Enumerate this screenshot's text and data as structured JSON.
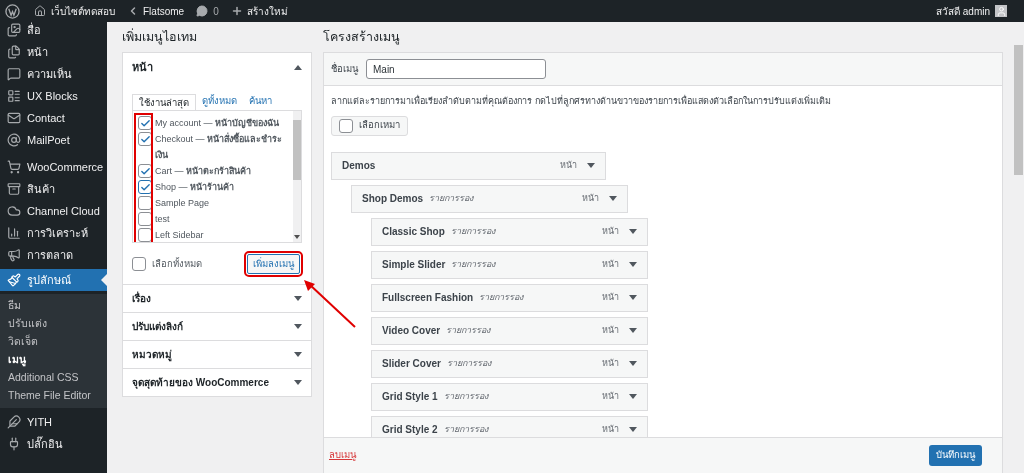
{
  "admin_bar": {
    "site_name": "เว็บไซต์ทดสอบ",
    "theme": "Flatsome",
    "comments": "0",
    "new_label": "สร้างใหม่",
    "greeting": "สวัสดี admin"
  },
  "sidebar": {
    "groups": [
      [
        {
          "label": "สื่อ",
          "selected": false
        },
        {
          "label": "หน้า",
          "selected": false
        },
        {
          "label": "ความเห็น",
          "selected": false
        },
        {
          "label": "UX Blocks",
          "selected": false
        },
        {
          "label": "Contact",
          "selected": false
        },
        {
          "label": "MailPoet",
          "selected": false
        }
      ],
      [
        {
          "label": "WooCommerce",
          "selected": false
        },
        {
          "label": "สินค้า",
          "selected": false
        },
        {
          "label": "Channel Cloud",
          "selected": false
        },
        {
          "label": "การวิเคราะห์",
          "selected": false
        },
        {
          "label": "การตลาด",
          "selected": false
        },
        {
          "label": "รูปลักษณ์",
          "selected": true,
          "children": [
            {
              "label": "ธีม",
              "selected": false
            },
            {
              "label": "ปรับแต่ง",
              "selected": false
            },
            {
              "label": "วิดเจ็ต",
              "selected": false
            },
            {
              "label": "เมนู",
              "selected": true
            },
            {
              "label": "Additional CSS",
              "selected": false
            },
            {
              "label": "Theme File Editor",
              "selected": false
            }
          ]
        },
        {
          "label": "YITH",
          "selected": false
        },
        {
          "label": "ปลั๊กอิน",
          "selected": false
        }
      ]
    ]
  },
  "add_items": {
    "title": "เพิ่มเมนูไอเทม",
    "sections": [
      {
        "title": "หน้า",
        "expanded": true,
        "tabs": [
          {
            "label": "ใช้งานล่าสุด",
            "selected": true
          },
          {
            "label": "ดูทั้งหมด",
            "selected": false
          },
          {
            "label": "ค้นหา",
            "selected": false
          }
        ],
        "items": [
          {
            "label": "My account — **หน้าบัญชีของฉัน**",
            "checked": true
          },
          {
            "label": "Checkout — **หน้าสั่งซื้อและชำระเงิน**",
            "checked": true
          },
          {
            "label": "Cart — **หน้าตะกร้าสินค้า**",
            "checked": true
          },
          {
            "label": "Shop — **หน้าร้านค้า**",
            "checked": true
          },
          {
            "label": "Sample Page",
            "checked": false
          },
          {
            "label": "test",
            "checked": false
          },
          {
            "label": "Left Sidebar",
            "checked": false
          }
        ],
        "select_all": {
          "label": "เลือกทั้งหมด",
          "checked": false
        },
        "add_button": "เพิ่มลงเมนู"
      },
      {
        "title": "เรื่อง",
        "expanded": false
      },
      {
        "title": "ปรับแต่งลิงก์",
        "expanded": false
      },
      {
        "title": "หมวดหมู่",
        "expanded": false
      },
      {
        "title": "จุดสุดท้ายของ WooCommerce",
        "expanded": false
      }
    ]
  },
  "menu_structure": {
    "title": "โครงสร้างเมนู",
    "name_label": "ชื่อเมนู",
    "name_value": "Main",
    "instructions": "ลากแต่ละรายการมาเพื่อเรียงลำดับตามที่คุณต้องการ กดไปที่ลูกศรทางด้านขวาของรายการเพื่อแสดงตัวเลือกในการปรับแต่งเพิ่มเติม",
    "bulk_select": {
      "label": "เลือกเหมา",
      "checked": false
    },
    "items": [
      {
        "title": "Demos",
        "type": "หน้า",
        "children": [
          {
            "title": "Shop Demos",
            "sub": "รายการรอง",
            "type": "หน้า",
            "children": [
              {
                "title": "Classic Shop",
                "sub": "รายการรอง",
                "type": "หน้า"
              },
              {
                "title": "Simple Slider",
                "sub": "รายการรอง",
                "type": "หน้า"
              },
              {
                "title": "Fullscreen Fashion",
                "sub": "รายการรอง",
                "type": "หน้า"
              },
              {
                "title": "Video Cover",
                "sub": "รายการรอง",
                "type": "หน้า"
              },
              {
                "title": "Slider Cover",
                "sub": "รายการรอง",
                "type": "หน้า"
              },
              {
                "title": "Grid Style 1",
                "sub": "รายการรอง",
                "type": "หน้า"
              },
              {
                "title": "Grid Style 2",
                "sub": "รายการรอง",
                "type": "หน้า"
              }
            ]
          }
        ]
      }
    ],
    "delete_link": "ลบเมนู",
    "save_button": "บันทึกเมนู"
  }
}
